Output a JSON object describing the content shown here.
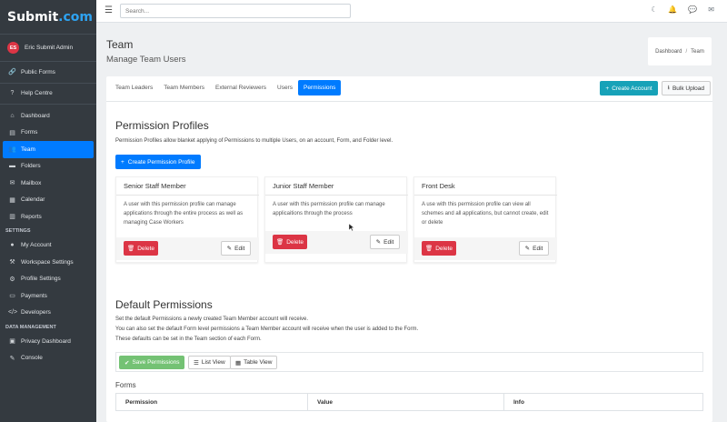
{
  "app": {
    "logo_main": "Submit",
    "logo_dot": ".com"
  },
  "user": {
    "initials": "ES",
    "name": "Eric Submit Admin"
  },
  "sidebar": {
    "top_items": [
      {
        "label": "Public Forms",
        "icon": "link-icon"
      },
      {
        "label": "Help Centre",
        "icon": "question-icon"
      }
    ],
    "main_items": [
      {
        "label": "Dashboard",
        "icon": "home-icon"
      },
      {
        "label": "Forms",
        "icon": "file-icon"
      },
      {
        "label": "Team",
        "icon": "users-icon"
      },
      {
        "label": "Folders",
        "icon": "folder-icon"
      },
      {
        "label": "Mailbox",
        "icon": "inbox-icon"
      },
      {
        "label": "Calendar",
        "icon": "calendar-icon"
      },
      {
        "label": "Reports",
        "icon": "chart-icon"
      }
    ],
    "settings_header": "SETTINGS",
    "settings_items": [
      {
        "label": "My Account",
        "icon": "user-icon"
      },
      {
        "label": "Workspace Settings",
        "icon": "wrench-icon"
      },
      {
        "label": "Profile Settings",
        "icon": "user-cog-icon"
      },
      {
        "label": "Payments",
        "icon": "credit-card-icon"
      },
      {
        "label": "Developers",
        "icon": "code-icon"
      }
    ],
    "data_header": "DATA MANAGEMENT",
    "data_items": [
      {
        "label": "Privacy Dashboard",
        "icon": "window-icon"
      },
      {
        "label": "Console",
        "icon": "edit-icon"
      }
    ],
    "active": "Team"
  },
  "topbar": {
    "search_placeholder": "Search..."
  },
  "header": {
    "title": "Team",
    "subtitle": "Manage Team Users"
  },
  "breadcrumb": {
    "home": "Dashboard",
    "current": "Team",
    "separator": "/"
  },
  "tabs": [
    "Team Leaders",
    "Team Members",
    "External Reviewers",
    "Users",
    "Permissions"
  ],
  "active_tab": "Permissions",
  "actions": {
    "create_account": "Create Account",
    "bulk_upload": "Bulk Upload"
  },
  "permission_profiles": {
    "title": "Permission Profiles",
    "description": "Permission Profiles allow blanket applying of Permissions to multiple Users, on an account, Form, and Folder level.",
    "create_button": "Create Permission Profile",
    "profiles": [
      {
        "name": "Senior Staff Member",
        "description": "A user with this permission profile can manage applications through the entire process as well as managing Case Workers"
      },
      {
        "name": "Junior Staff Member",
        "description": "A user with this permission profile can manage applicaitions through the process"
      },
      {
        "name": "Front Desk",
        "description": "A use with this permission profile can view all schemes and all applications, but cannot create, edit or delete"
      }
    ],
    "delete_label": "Delete",
    "edit_label": "Edit"
  },
  "default_permissions": {
    "title": "Default Permissions",
    "lines": [
      "Set the default Permissions a newly created Team Member account will receive.",
      "You can also set the default Form level permissions a Team Member account will receive when the user is added to the Form.",
      "These defaults can be set in the Team section of each Form."
    ],
    "save_button": "Save Permissions",
    "list_view": "List View",
    "table_view": "Table View",
    "forms_label": "Forms",
    "columns": [
      "Permission",
      "Value",
      "Info"
    ]
  },
  "colors": {
    "sidebar": "#343a40",
    "primary": "#007bff",
    "teal": "#17a2b8",
    "danger": "#dc3545",
    "success": "#5cb85c"
  }
}
